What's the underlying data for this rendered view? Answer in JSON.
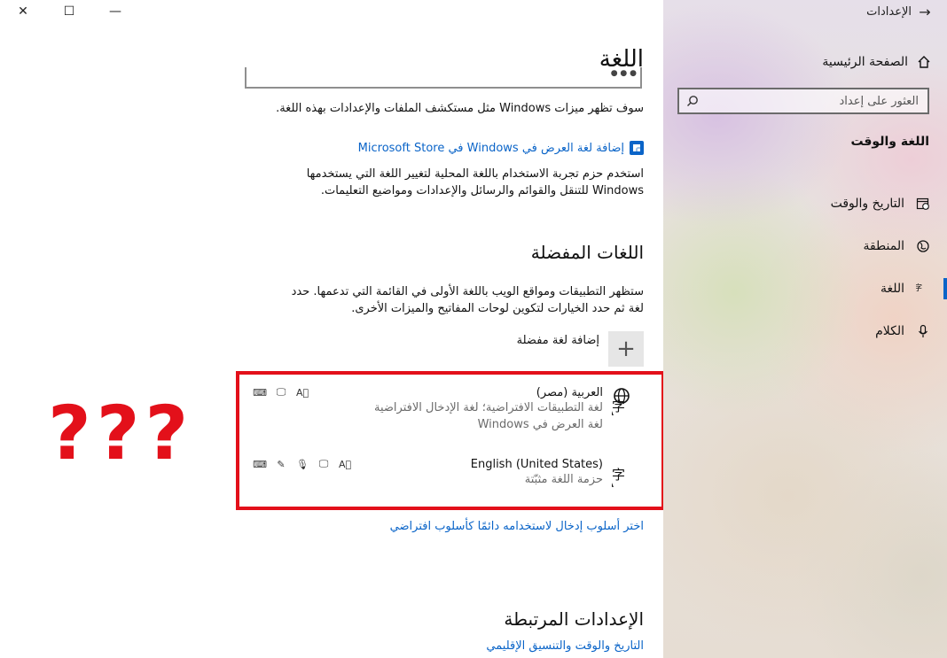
{
  "window": {
    "title": "الإعدادات",
    "close_glyph": "✕",
    "maximize_glyph": "☐",
    "minimize_glyph": "—"
  },
  "sidebar": {
    "home_label": "الصفحة الرئيسية",
    "search_placeholder": "العثور على إعداد",
    "section_title": "اللغة والوقت",
    "items": [
      {
        "label": "التاريخ والوقت",
        "icon": "calendar-clock-icon"
      },
      {
        "label": "المنطقة",
        "icon": "globe-region-icon"
      },
      {
        "label": "اللغة",
        "icon": "language-icon",
        "active": true
      },
      {
        "label": "الكلام",
        "icon": "microphone-icon"
      }
    ]
  },
  "main": {
    "title": "اللغة",
    "dropdown_partial_text": "● ● ●",
    "windows_features_note": "سوف تظهر ميزات Windows مثل مستكشف الملفات والإعدادات بهذه اللغة.",
    "store_link": "إضافة لغة العرض في Windows في Microsoft Store",
    "lxp_note_line1": "استخدم حزم تجربة الاستخدام باللغة المحلية لتغيير اللغة التي يستخدمها",
    "lxp_note_line2": "Windows للتنقل والقوائم والرسائل والإعدادات ومواضيع التعليمات.",
    "preferred_title": "اللغات المفضلة",
    "preferred_desc_line1": "ستظهر التطبيقات ومواقع الويب باللغة الأولى في القائمة التي تدعمها. حدد",
    "preferred_desc_line2": "لغة ثم حدد الخيارات لتكوين لوحات المفاتيح والميزات الأخرى.",
    "add_language_label": "إضافة لغة مفضلة",
    "languages": [
      {
        "name": "العربية (مصر)",
        "sub1": "لغة التطبيقات الافتراضية؛ لغة الإدخال الافتراضية",
        "sub2": "لغة العرض في Windows",
        "features": [
          "keyboard-icon",
          "display-icon",
          "text-translate-icon"
        ]
      },
      {
        "name": "English (United States)",
        "sub1": "حزمة اللغة مثبّتة",
        "features": [
          "keyboard-icon",
          "handwriting-icon",
          "speech-icon",
          "display-icon",
          "text-translate-icon"
        ]
      }
    ],
    "input_method_link": "اختر أسلوب إدخال لاستخدامه دائمًا كأسلوب افتراضي",
    "related_title": "الإعدادات المرتبطة",
    "related_link": "التاريخ والوقت والتنسيق الإقليمي"
  },
  "annotation": {
    "question_marks": "???",
    "color": "#e3101a"
  },
  "colors": {
    "accent": "#0a64c8",
    "highlight_border": "#e3101a"
  }
}
